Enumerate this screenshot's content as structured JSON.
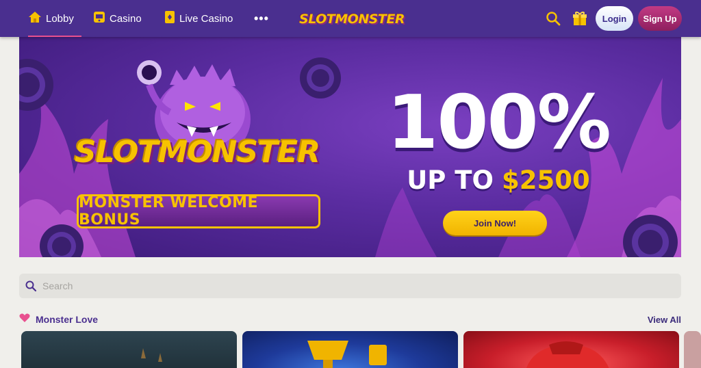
{
  "nav": {
    "items": [
      {
        "label": "Lobby",
        "icon": "home-icon",
        "active": true
      },
      {
        "label": "Casino",
        "icon": "slot-machine-icon",
        "active": false
      },
      {
        "label": "Live Casino",
        "icon": "card-icon",
        "active": false
      }
    ],
    "more_label": "•••",
    "logo_text": "SLOTMONSTER",
    "login_label": "Login",
    "signup_label": "Sign Up"
  },
  "banner": {
    "brand_text": "SLOTMONSTER",
    "subtitle": "MONSTER WELCOME BONUS",
    "headline": "100%",
    "upto_prefix": "UP TO",
    "upto_amount": "$2500",
    "cta_label": "Join Now!"
  },
  "search": {
    "placeholder": "Search"
  },
  "section": {
    "title": "Monster Love",
    "icon": "heart-icon",
    "view_all_label": "View All"
  },
  "colors": {
    "nav_bg": "#4a2f8f",
    "accent_pink": "#e8508f",
    "gold": "#f7c200",
    "signup": "#b02a72",
    "page_bg": "#f0efeb"
  }
}
